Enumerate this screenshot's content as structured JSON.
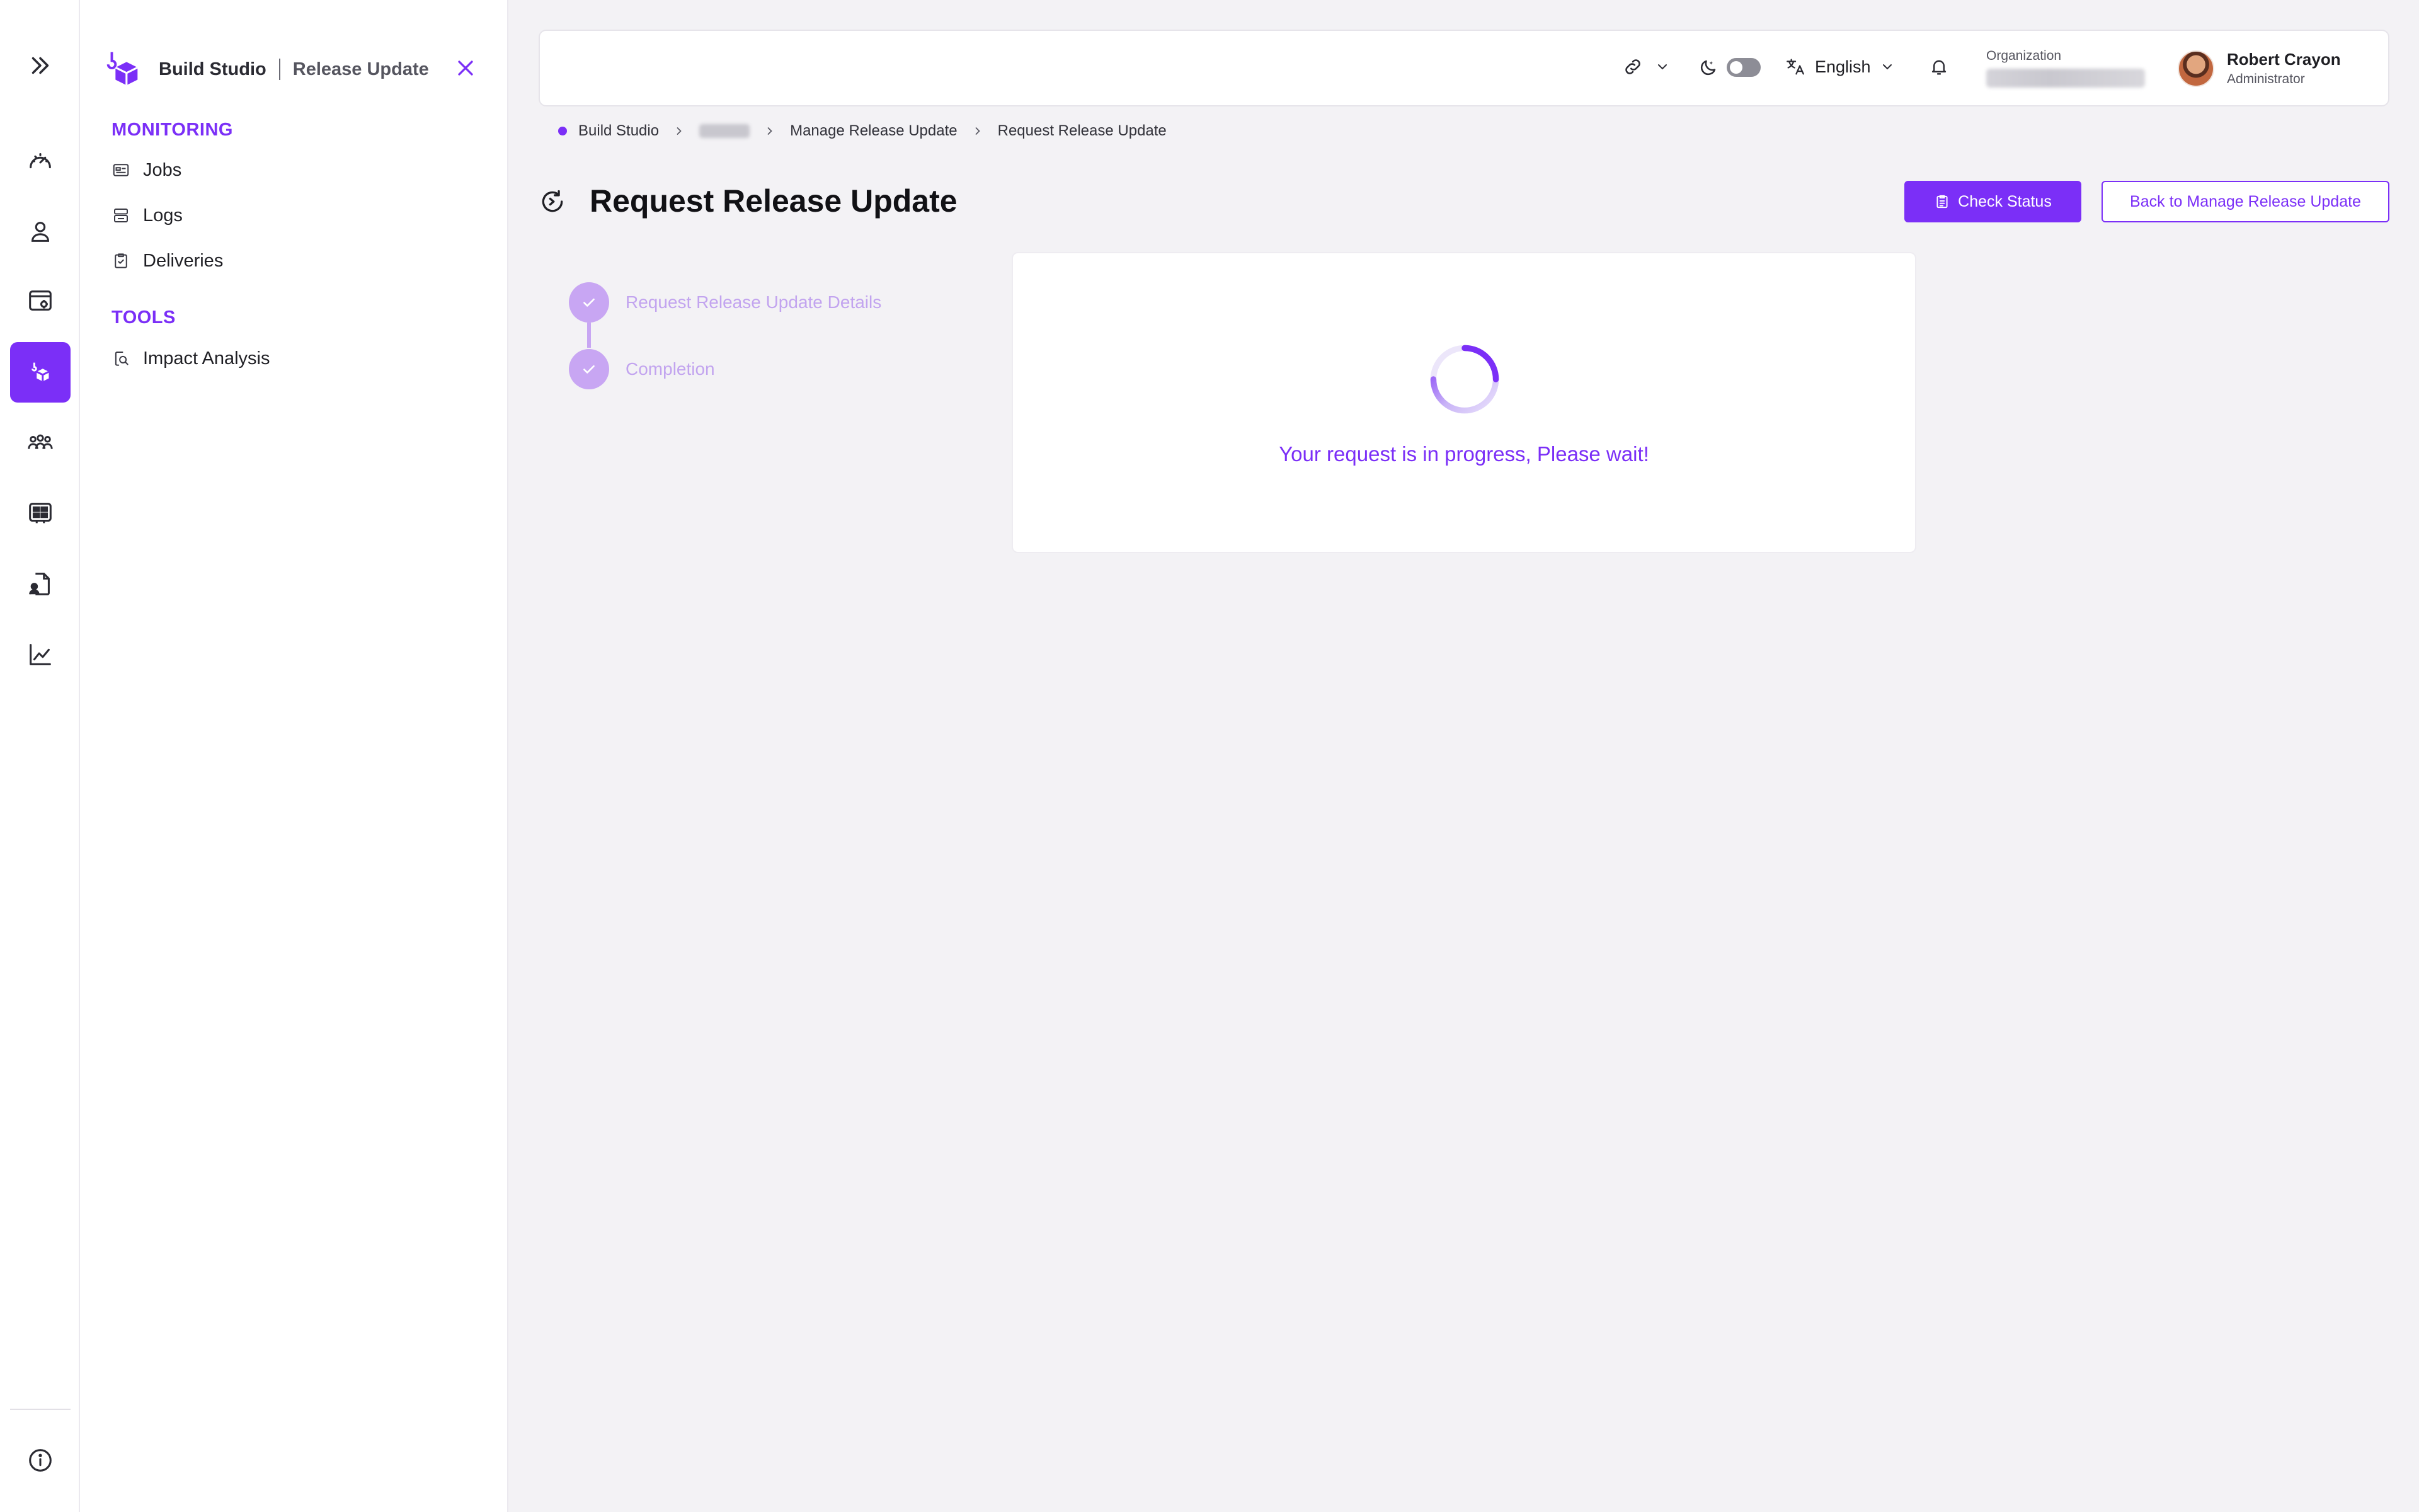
{
  "sidebar_rail": {
    "items": [
      {
        "icon": "expand-chevrons-icon"
      },
      {
        "icon": "dashboard-gauge-icon"
      },
      {
        "icon": "user-icon"
      },
      {
        "icon": "settings-window-icon"
      },
      {
        "icon": "build-studio-icon",
        "active": true
      },
      {
        "icon": "team-icon"
      },
      {
        "icon": "grid-board-icon"
      },
      {
        "icon": "document-person-icon"
      },
      {
        "icon": "analytics-chart-icon"
      },
      {
        "icon": "info-icon"
      }
    ]
  },
  "panel": {
    "app_name": "Build Studio",
    "app_section": "Release Update",
    "sections": [
      {
        "title": "MONITORING",
        "items": [
          "Jobs",
          "Logs",
          "Deliveries"
        ]
      },
      {
        "title": "TOOLS",
        "items": [
          "Impact Analysis"
        ]
      }
    ]
  },
  "topbar": {
    "language": "English",
    "org_label": "Organization",
    "user_name": "Robert Crayon",
    "user_role": "Administrator"
  },
  "breadcrumb": {
    "items": [
      "Build Studio",
      "Manage Release Update",
      "Request Release Update"
    ]
  },
  "page": {
    "title": "Request Release Update",
    "check_status_label": "Check Status",
    "back_label": "Back to Manage Release Update"
  },
  "stepper": {
    "steps": [
      "Request Release Update Details",
      "Completion"
    ]
  },
  "progress": {
    "message": "Your request is in progress, Please wait!"
  },
  "colors": {
    "accent": "#7b2ff7",
    "step_muted": "#c8a6f3",
    "background": "#f3f2f5"
  }
}
